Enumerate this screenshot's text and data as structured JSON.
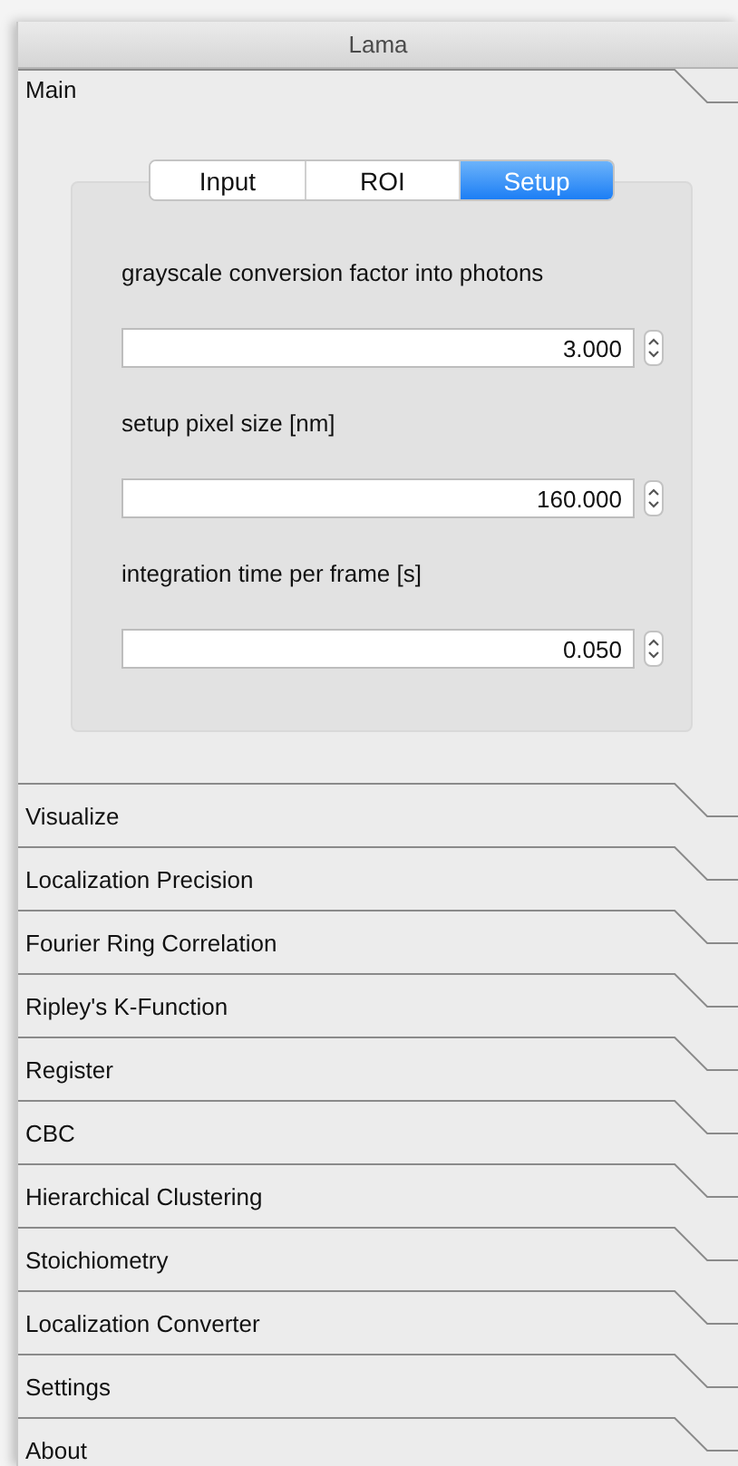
{
  "window": {
    "title": "Lama"
  },
  "main": {
    "label": "Main",
    "tabs": [
      {
        "label": "Input",
        "selected": false
      },
      {
        "label": "ROI",
        "selected": false
      },
      {
        "label": "Setup",
        "selected": true
      }
    ],
    "fields": [
      {
        "label": "grayscale conversion factor into photons",
        "value": "3.000"
      },
      {
        "label": "setup pixel size [nm]",
        "value": "160.000"
      },
      {
        "label": "integration time per frame [s]",
        "value": "0.050"
      }
    ]
  },
  "sections": [
    {
      "label": "Visualize"
    },
    {
      "label": "Localization Precision"
    },
    {
      "label": "Fourier Ring Correlation"
    },
    {
      "label": "Ripley's K-Function"
    },
    {
      "label": "Register"
    },
    {
      "label": "CBC"
    },
    {
      "label": "Hierarchical Clustering"
    },
    {
      "label": "Stoichiometry"
    },
    {
      "label": "Localization Converter"
    },
    {
      "label": "Settings"
    },
    {
      "label": "About"
    }
  ]
}
